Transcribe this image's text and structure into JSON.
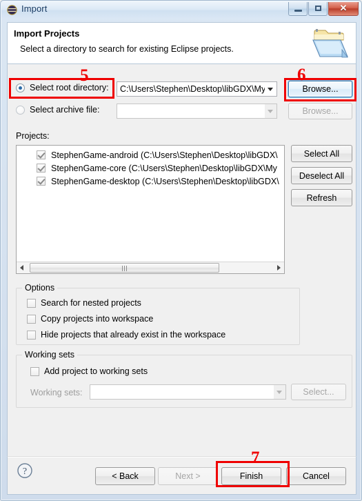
{
  "window": {
    "title": "Import",
    "icon": "eclipse-globe-icon",
    "controls": {
      "minimize": "minimize-icon",
      "maximize": "maximize-icon",
      "close": "✕"
    }
  },
  "header": {
    "title": "Import Projects",
    "subtitle": "Select a directory to search for existing Eclipse projects.",
    "icon": "open-folder-icon"
  },
  "source": {
    "root_directory": {
      "label": "Select root directory:",
      "selected": true,
      "value": "C:\\Users\\Stephen\\Desktop\\libGDX\\My",
      "browse_label": "Browse..."
    },
    "archive_file": {
      "label": "Select archive file:",
      "selected": false,
      "value": "",
      "browse_label": "Browse..."
    }
  },
  "projects": {
    "label": "Projects:",
    "items": [
      {
        "name": "StephenGame-android (C:\\Users\\Stephen\\Desktop\\libGDX\\",
        "checked": true
      },
      {
        "name": "StephenGame-core (C:\\Users\\Stephen\\Desktop\\libGDX\\My",
        "checked": true
      },
      {
        "name": "StephenGame-desktop (C:\\Users\\Stephen\\Desktop\\libGDX\\",
        "checked": true
      }
    ],
    "buttons": {
      "select_all": "Select All",
      "deselect_all": "Deselect All",
      "refresh": "Refresh"
    }
  },
  "options": {
    "title": "Options",
    "items": [
      {
        "label": "Search for nested projects",
        "checked": false
      },
      {
        "label": "Copy projects into workspace",
        "checked": false
      },
      {
        "label": "Hide projects that already exist in the workspace",
        "checked": false
      }
    ]
  },
  "working_sets": {
    "title": "Working sets",
    "add_label": "Add project to working sets",
    "add_checked": false,
    "combo_label": "Working sets:",
    "combo_value": "",
    "select_label": "Select...",
    "disabled": true
  },
  "footer": {
    "help": "?",
    "back": "< Back",
    "next": "Next >",
    "finish": "Finish",
    "cancel": "Cancel",
    "next_disabled": true
  },
  "annotations": {
    "color": "#ef0000",
    "markers": [
      {
        "number": "5",
        "target": "select-root-directory-radio"
      },
      {
        "number": "6",
        "target": "browse-root-button"
      },
      {
        "number": "7",
        "target": "finish-button"
      }
    ]
  }
}
